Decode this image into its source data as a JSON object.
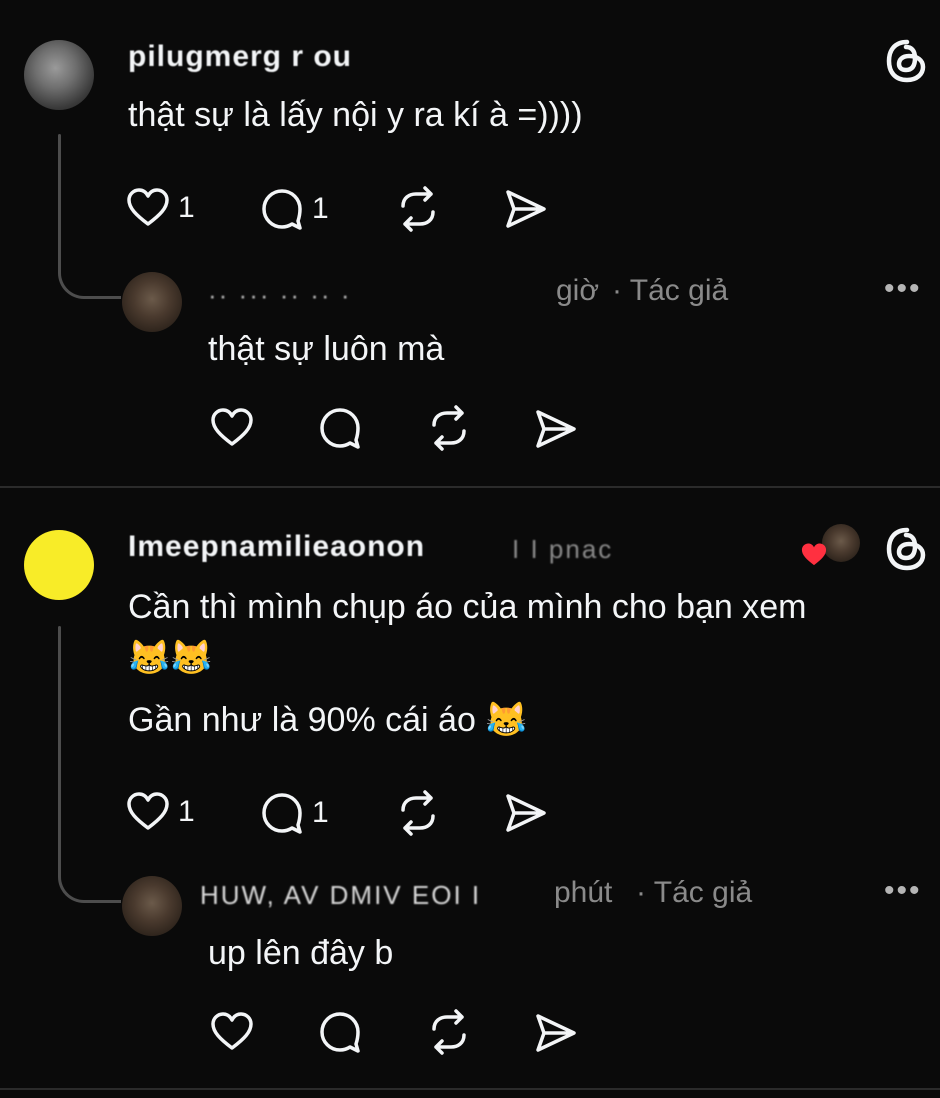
{
  "post1": {
    "username": "pilugmerg r ou",
    "text": "thật sự là lấy nội y ra kí à =))))",
    "like_count": "1",
    "reply_count": "1"
  },
  "reply1": {
    "name_obscured": "·· ··· ·· ·· ·",
    "time_suffix": "giờ",
    "author_label": "· Tác giả",
    "text": "thật sự luôn mà",
    "more_label": "•••"
  },
  "post2": {
    "username": "Imeepnamilieaonon",
    "username_suffix": "I I pnac",
    "line1": "Cần thì mình chụp áo của mình cho bạn xem",
    "emojis_line2": "😹😹",
    "line3": "Gần như là 90% cái áo",
    "emoji_line3": "😹",
    "like_count": "1",
    "reply_count": "1"
  },
  "reply2": {
    "name_obscured": "HUW, AV DMIV EOI I",
    "time_suffix": "phút",
    "author_label": "· Tác giả",
    "text": "up lên đây b",
    "more_label": "•••"
  },
  "icons": {
    "brand": "threads-logo-icon",
    "like": "heart-icon",
    "reply": "comment-bubble-icon",
    "repost": "repost-icon",
    "share": "send-icon"
  },
  "colors": {
    "background": "#0a0a0a",
    "text": "#f3f5f7",
    "muted": "#8a8a8a",
    "line": "#4d4d4d",
    "heart_badge": "#ff3040",
    "yellow_avatar": "#f8ec28"
  }
}
